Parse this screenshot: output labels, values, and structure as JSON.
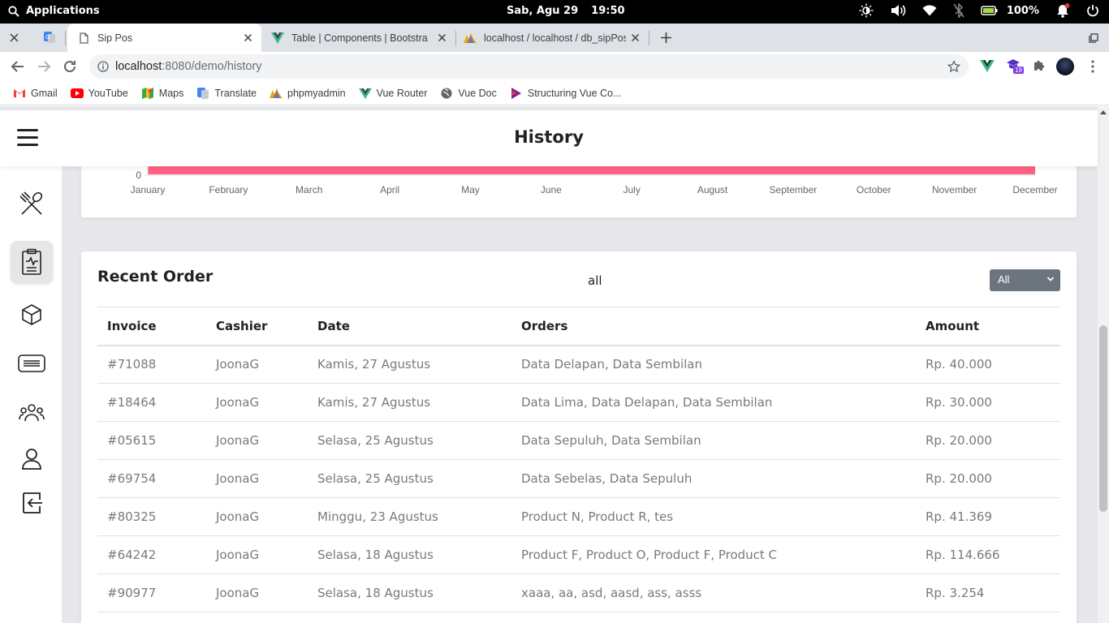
{
  "os": {
    "applications": "Applications",
    "date": "Sab, Agu 29",
    "time": "19:50",
    "battery": "100%"
  },
  "tabs": [
    {
      "title": "Sip Pos",
      "icon": "page-icon",
      "active": true
    },
    {
      "title": "Table | Components | Bootstra",
      "icon": "vue-icon"
    },
    {
      "title": "localhost / localhost / db_sipPos",
      "icon": "pma-icon"
    }
  ],
  "address": {
    "host": "localhost",
    "path": ":8080/demo/history"
  },
  "extensions": {
    "badge": "19"
  },
  "bookmarks": [
    {
      "label": "Gmail",
      "icon": "gmail-icon"
    },
    {
      "label": "YouTube",
      "icon": "youtube-icon"
    },
    {
      "label": "Maps",
      "icon": "maps-icon"
    },
    {
      "label": "Translate",
      "icon": "translate-icon"
    },
    {
      "label": "phpmyadmin",
      "icon": "pma-icon"
    },
    {
      "label": "Vue Router",
      "icon": "vue-icon"
    },
    {
      "label": "Vue Doc",
      "icon": "globe-icon"
    },
    {
      "label": "Structuring Vue Co...",
      "icon": "bookmark-icon"
    }
  ],
  "header": {
    "title": "History"
  },
  "sidebar": {
    "items": [
      {
        "icon": "utensils-icon",
        "active": false
      },
      {
        "icon": "clipboard-icon",
        "active": true
      },
      {
        "icon": "box-icon",
        "active": false
      },
      {
        "icon": "list-icon",
        "active": false
      },
      {
        "icon": "users-icon",
        "active": false
      },
      {
        "icon": "user-icon",
        "active": false
      },
      {
        "icon": "logout-icon",
        "active": false
      }
    ]
  },
  "chart_data": {
    "type": "bar",
    "categories": [
      "January",
      "February",
      "March",
      "April",
      "May",
      "June",
      "July",
      "August",
      "September",
      "October",
      "November",
      "December"
    ],
    "y_ticks_visible": [
      "0"
    ],
    "bar_color": "#ff6384",
    "note_visible": "only the bottom of the bar chart is visible; bars appear as a single continuous red band at the baseline"
  },
  "recent_order": {
    "title": "Recent Order",
    "filter_label": "all",
    "filter_value": "All",
    "columns": [
      "Invoice",
      "Cashier",
      "Date",
      "Orders",
      "Amount"
    ],
    "rows": [
      [
        "#71088",
        "JoonaG",
        "Kamis, 27 Agustus",
        "Data Delapan, Data Sembilan",
        "Rp. 40.000"
      ],
      [
        "#18464",
        "JoonaG",
        "Kamis, 27 Agustus",
        "Data Lima, Data Delapan, Data Sembilan",
        "Rp. 30.000"
      ],
      [
        "#05615",
        "JoonaG",
        "Selasa, 25 Agustus",
        "Data Sepuluh, Data Sembilan",
        "Rp. 20.000"
      ],
      [
        "#69754",
        "JoonaG",
        "Selasa, 25 Agustus",
        "Data Sebelas, Data Sepuluh",
        "Rp. 20.000"
      ],
      [
        "#80325",
        "JoonaG",
        "Minggu, 23 Agustus",
        "Product N, Product R, tes",
        "Rp. 41.369"
      ],
      [
        "#64242",
        "JoonaG",
        "Selasa, 18 Agustus",
        "Product F, Product O, Product F, Product C",
        "Rp. 114.666"
      ],
      [
        "#90977",
        "JoonaG",
        "Selasa, 18 Agustus",
        "xaaa, aa, asd, aasd, ass, asss",
        "Rp. 3.254"
      ]
    ]
  }
}
